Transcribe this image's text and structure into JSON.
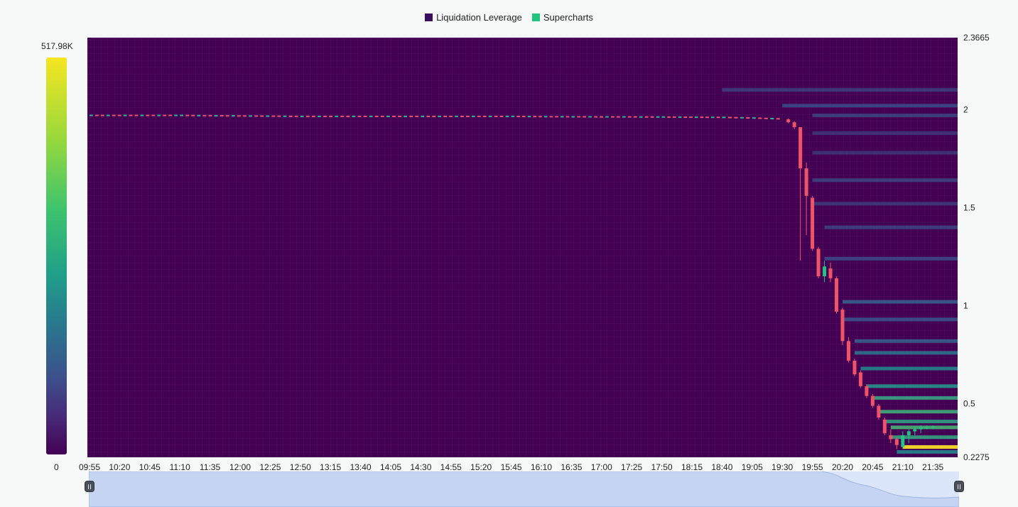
{
  "legend": [
    {
      "label": "Liquidation Leverage",
      "color": "#3a0f5c"
    },
    {
      "label": "Supercharts",
      "color": "#21c47e"
    }
  ],
  "colorbar": {
    "max_label": "517.98K",
    "min_label": "0"
  },
  "chart_data": {
    "type": "heatmap",
    "title": "",
    "series_names": [
      "Liquidation Leverage",
      "Supercharts"
    ],
    "x_tick_labels": [
      "09:55",
      "10:20",
      "10:45",
      "11:10",
      "11:35",
      "12:00",
      "12:25",
      "12:50",
      "13:15",
      "13:40",
      "14:05",
      "14:30",
      "14:55",
      "15:20",
      "15:45",
      "16:10",
      "16:35",
      "17:00",
      "17:25",
      "17:50",
      "18:15",
      "18:40",
      "19:05",
      "19:30",
      "19:55",
      "20:20",
      "20:45",
      "21:10",
      "21:35"
    ],
    "y_tick_labels": [
      "2.3665",
      "2",
      "1.5",
      "1",
      "0.5",
      "0.2275"
    ],
    "ylim": [
      0.2275,
      2.3665
    ],
    "colorbar_range": [
      0,
      517980
    ],
    "price_line": [
      [
        "09:55",
        1.97
      ],
      [
        "11:10",
        1.97
      ],
      [
        "12:50",
        1.965
      ],
      [
        "14:30",
        1.965
      ],
      [
        "15:45",
        1.965
      ],
      [
        "16:35",
        1.963
      ],
      [
        "17:50",
        1.962
      ],
      [
        "18:40",
        1.96
      ],
      [
        "19:05",
        1.957
      ],
      [
        "19:30",
        1.952
      ]
    ],
    "candles": [
      {
        "time": "19:35",
        "open": 1.95,
        "high": 1.955,
        "low": 1.93,
        "close": 1.935
      },
      {
        "time": "19:40",
        "open": 1.935,
        "high": 1.94,
        "low": 1.9,
        "close": 1.91
      },
      {
        "time": "19:45",
        "open": 1.91,
        "high": 1.91,
        "low": 1.23,
        "close": 1.7
      },
      {
        "time": "19:50",
        "open": 1.7,
        "high": 1.73,
        "low": 1.36,
        "close": 1.56
      },
      {
        "time": "19:55",
        "open": 1.55,
        "high": 1.56,
        "low": 1.28,
        "close": 1.29
      },
      {
        "time": "20:00",
        "open": 1.29,
        "high": 1.3,
        "low": 1.14,
        "close": 1.15
      },
      {
        "time": "20:05",
        "open": 1.15,
        "high": 1.23,
        "low": 1.12,
        "close": 1.2
      },
      {
        "time": "20:10",
        "open": 1.19,
        "high": 1.22,
        "low": 1.12,
        "close": 1.14
      },
      {
        "time": "20:15",
        "open": 1.14,
        "high": 1.15,
        "low": 0.96,
        "close": 0.97
      },
      {
        "time": "20:20",
        "open": 0.98,
        "high": 0.99,
        "low": 0.8,
        "close": 0.82
      },
      {
        "time": "20:25",
        "open": 0.82,
        "high": 0.84,
        "low": 0.71,
        "close": 0.72
      },
      {
        "time": "20:30",
        "open": 0.72,
        "high": 0.73,
        "low": 0.64,
        "close": 0.65
      },
      {
        "time": "20:35",
        "open": 0.66,
        "high": 0.67,
        "low": 0.58,
        "close": 0.59
      },
      {
        "time": "20:40",
        "open": 0.59,
        "high": 0.6,
        "low": 0.53,
        "close": 0.54
      },
      {
        "time": "20:45",
        "open": 0.54,
        "high": 0.55,
        "low": 0.48,
        "close": 0.49
      },
      {
        "time": "20:50",
        "open": 0.49,
        "high": 0.5,
        "low": 0.42,
        "close": 0.43
      },
      {
        "time": "20:55",
        "open": 0.42,
        "high": 0.43,
        "low": 0.34,
        "close": 0.35
      },
      {
        "time": "21:00",
        "open": 0.34,
        "high": 0.37,
        "low": 0.3,
        "close": 0.32
      },
      {
        "time": "21:05",
        "open": 0.32,
        "high": 0.33,
        "low": 0.27,
        "close": 0.29
      },
      {
        "time": "21:10",
        "open": 0.28,
        "high": 0.36,
        "low": 0.27,
        "close": 0.34
      },
      {
        "time": "21:15",
        "open": 0.34,
        "high": 0.37,
        "low": 0.3,
        "close": 0.36
      },
      {
        "time": "21:20",
        "open": 0.36,
        "high": 0.38,
        "low": 0.34,
        "close": 0.37
      },
      {
        "time": "21:25",
        "open": 0.37,
        "high": 0.39,
        "low": 0.35,
        "close": 0.38
      },
      {
        "time": "21:30",
        "open": 0.38,
        "high": 0.39,
        "low": 0.37,
        "close": 0.38
      },
      {
        "time": "21:35",
        "open": 0.38,
        "high": 0.39,
        "low": 0.37,
        "close": 0.385
      }
    ],
    "liquidation_levels": [
      {
        "price": 2.1,
        "from": "18:40",
        "intensity": 0.18
      },
      {
        "price": 2.02,
        "from": "19:30",
        "intensity": 0.22
      },
      {
        "price": 1.97,
        "from": "19:55",
        "intensity": 0.2
      },
      {
        "price": 1.88,
        "from": "19:55",
        "intensity": 0.16
      },
      {
        "price": 1.78,
        "from": "19:55",
        "intensity": 0.16
      },
      {
        "price": 1.64,
        "from": "19:55",
        "intensity": 0.2
      },
      {
        "price": 1.52,
        "from": "19:55",
        "intensity": 0.17
      },
      {
        "price": 1.4,
        "from": "20:05",
        "intensity": 0.2
      },
      {
        "price": 1.24,
        "from": "20:05",
        "intensity": 0.22
      },
      {
        "price": 1.02,
        "from": "20:20",
        "intensity": 0.3
      },
      {
        "price": 0.93,
        "from": "20:20",
        "intensity": 0.25
      },
      {
        "price": 0.82,
        "from": "20:30",
        "intensity": 0.3
      },
      {
        "price": 0.76,
        "from": "20:30",
        "intensity": 0.38
      },
      {
        "price": 0.68,
        "from": "20:35",
        "intensity": 0.45
      },
      {
        "price": 0.59,
        "from": "20:40",
        "intensity": 0.52
      },
      {
        "price": 0.53,
        "from": "20:45",
        "intensity": 0.58
      },
      {
        "price": 0.46,
        "from": "20:50",
        "intensity": 0.62
      },
      {
        "price": 0.41,
        "from": "20:55",
        "intensity": 0.56
      },
      {
        "price": 0.38,
        "from": "21:00",
        "intensity": 0.65
      },
      {
        "price": 0.33,
        "from": "21:00",
        "intensity": 0.58
      },
      {
        "price": 0.28,
        "from": "21:10",
        "intensity": 1.0
      },
      {
        "price": 0.255,
        "from": "21:05",
        "intensity": 0.45
      }
    ]
  }
}
